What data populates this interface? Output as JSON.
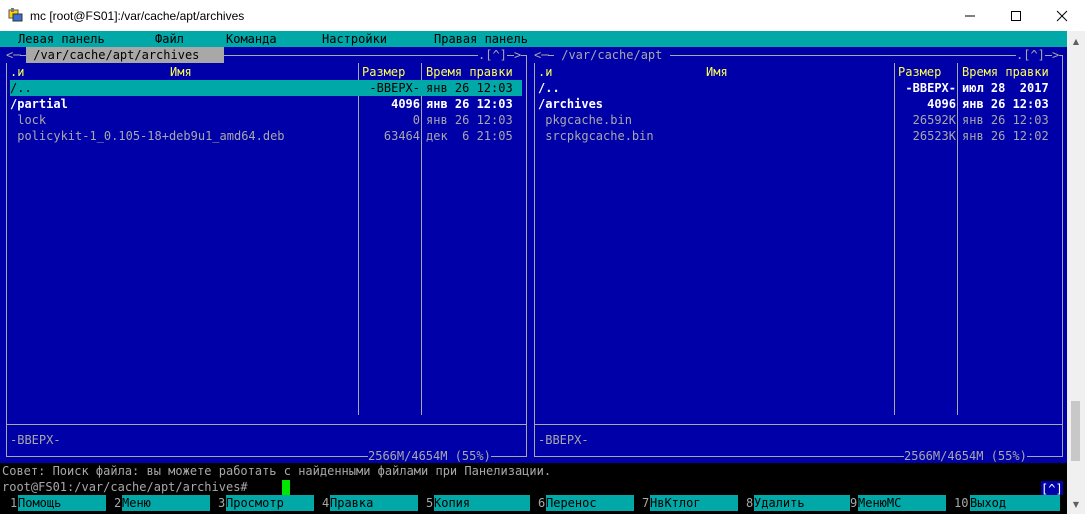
{
  "window": {
    "title": "mc [root@FS01]:/var/cache/apt/archives",
    "minimize": "—",
    "maximize": "☐",
    "close": "✕"
  },
  "menu": {
    "items": [
      "Левая панель",
      "Файл",
      "Команда",
      "Настройки",
      "Правая панель"
    ]
  },
  "left_panel": {
    "path": " /var/cache/apt/archives ",
    "corner": "<─",
    "history": ".[^]",
    "hist_arrow": ">",
    "headers": {
      "sort": ".и",
      "name": "Имя",
      "size": "Размер",
      "time": "Время правки"
    },
    "rows": [
      {
        "name": "/..",
        "size": "-ВВЕРХ-",
        "time": "янв 26 12:03",
        "selected": true,
        "dir": true
      },
      {
        "name": "/partial",
        "size": "4096",
        "time": "янв 26 12:03",
        "selected": false,
        "dir": true
      },
      {
        "name": " lock",
        "size": "0",
        "time": "янв 26 12:03",
        "selected": false,
        "dir": false
      },
      {
        "name": " policykit-1_0.105-18+deb9u1_amd64.deb",
        "size": "63464",
        "time": "дек  6 21:05",
        "selected": false,
        "dir": false
      }
    ],
    "status": "-ВВЕРХ-",
    "free": "2566M/4654M (55%)"
  },
  "right_panel": {
    "path": " /var/cache/apt ",
    "corner": "<─",
    "history": ".[^]",
    "hist_arrow": ">",
    "headers": {
      "sort": ".и",
      "name": "Имя",
      "size": "Размер",
      "time": "Время правки"
    },
    "rows": [
      {
        "name": "/..",
        "size": "-ВВЕРХ-",
        "time": "июл 28  2017",
        "dir": true
      },
      {
        "name": "/archives",
        "size": "4096",
        "time": "янв 26 12:03",
        "dir": true
      },
      {
        "name": " pkgcache.bin",
        "size": "26592K",
        "time": "янв 26 12:03",
        "dir": false
      },
      {
        "name": " srcpkgcache.bin",
        "size": "26523K",
        "time": "янв 26 12:02",
        "dir": false
      }
    ],
    "status": "-ВВЕРХ-",
    "free": "2566M/4654M (55%)"
  },
  "hint": "Совет: Поиск файла: вы можете работать с найденными файлами при Панелизации.",
  "prompt": "root@FS01:/var/cache/apt/archives#",
  "prompt_indicator": "[^]",
  "fkeys": [
    {
      "num": "1",
      "label": "Помощь"
    },
    {
      "num": "2",
      "label": "Меню"
    },
    {
      "num": "3",
      "label": "Просмотр"
    },
    {
      "num": "4",
      "label": "Правка"
    },
    {
      "num": "5",
      "label": "Копия"
    },
    {
      "num": "6",
      "label": "Перенос"
    },
    {
      "num": "7",
      "label": "НвКтлог"
    },
    {
      "num": "8",
      "label": "Удалить"
    },
    {
      "num": "9",
      "label": "МенюМС"
    },
    {
      "num": "10",
      "label": "Выход"
    }
  ],
  "scrollbar": {
    "up": "▲",
    "down": "▼"
  },
  "colors": {
    "panel_bg": "#0000a8",
    "cyan": "#00a8a8",
    "yellow": "#ffff54",
    "gray": "#a8a8a8"
  }
}
